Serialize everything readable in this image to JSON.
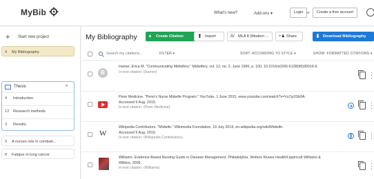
{
  "header": {
    "logo": "MyBib",
    "whats_new": "What's new?",
    "addons": "Add-ons ▾",
    "login": "Login",
    "or": "or",
    "create_account": "Create a free account"
  },
  "sidebar": {
    "start_project": "Start new project",
    "items": [
      {
        "num": "4",
        "label": "My Bibliography"
      },
      {
        "label": "Thesis"
      },
      {
        "num": "4",
        "label": "Introduction"
      },
      {
        "num": "12",
        "label": "Research methods"
      },
      {
        "num": "3",
        "label": "Results"
      },
      {
        "num": "9",
        "label": "A nurses role in combati..."
      },
      {
        "num": "8",
        "label": "Fatigue in lung cancer"
      }
    ]
  },
  "main": {
    "title": "My Bibliography",
    "buttons": {
      "create": "Create Citation",
      "import": "Import",
      "style": "MLA 8 (Modern ...",
      "share": "Share",
      "download": "Download Bibliography"
    },
    "search_placeholder": "Search my citations...",
    "filter": "FILTER ▾",
    "sort": "SORT: ACCORDING TO STYLE ▾",
    "show": "SHOW: FORMATTED CITATIONS ▾",
    "citations": [
      {
        "text": "Hamer, Erica M. \"Communicating Midwifery.\" Midwifery, vol. 12, no. 2, June 1996, p. 100, 10.1016/s0266-6138(96)90016-9.",
        "intext": "In-text citation: (Hamer)",
        "accessed": ""
      },
      {
        "text": "Penn Medicine. \"Penn's Nurse Midwife Program.\" YouTube, 1 June 2015, www.youtube.com/watch?v=Vu7ju3Sb9A.",
        "accessed": "Accessed 9 Aug. 2019.",
        "intext": "In-text citation: (Penn Medicine)"
      },
      {
        "text": "Wikipedia Contributors. \"Midwife.\" Wikimedia Foundation, 19 July 2019, en.wikipedia.org/wiki/Midwife.",
        "accessed": "Accessed 9 Aug. 2019.",
        "intext": "In-text citation: (Wikipedia Contributors)"
      },
      {
        "text": "Williams. Evidence-Based Nursing Guide to Disease Management. Philadelphia, Wolters Kluwer Health/Lippincott Williams & Wilkins, 2009.",
        "accessed": "",
        "intext": "In-text citation: (Williams)"
      }
    ]
  },
  "colors": {
    "accent_green": "#20a455",
    "accent_blue": "#1d79d6",
    "active_item": "#f3e9c7",
    "youtube_red": "#e52d27"
  }
}
